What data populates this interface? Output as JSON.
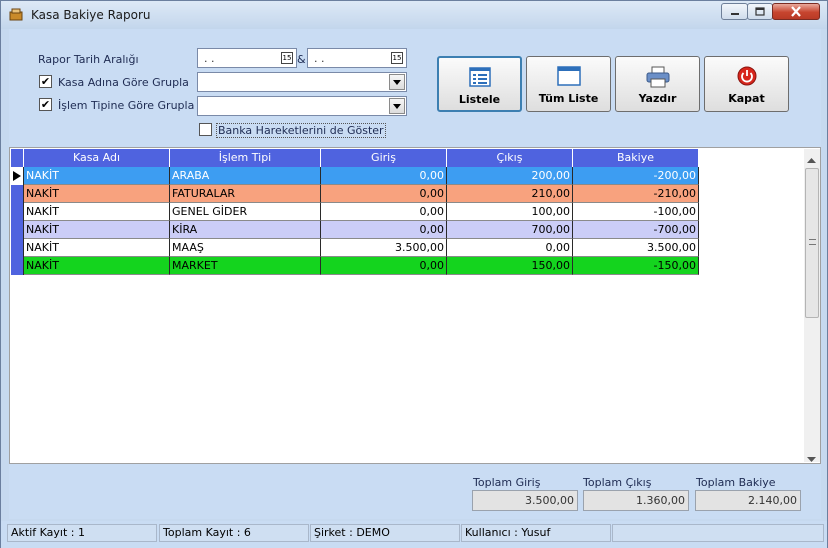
{
  "window": {
    "title": "Kasa Bakiye Raporu"
  },
  "filters": {
    "date_range_label": "Rapor Tarih Aralığı",
    "date_start": ". .",
    "date_end": ". .",
    "date_separator": "&",
    "group_by_cash_label": "Kasa Adına Göre Grupla",
    "group_by_cash_checked": true,
    "group_by_type_label": "İşlem Tipine Göre Grupla",
    "group_by_type_checked": true,
    "show_bank_label": "Banka Hareketlerini de Göster",
    "show_bank_checked": false
  },
  "buttons": {
    "list": "Listele",
    "all_list": "Tüm Liste",
    "print": "Yazdır",
    "close": "Kapat"
  },
  "grid": {
    "columns": [
      "Kasa Adı",
      "İşlem Tipi",
      "Giriş",
      "Çıkış",
      "Bakiye"
    ],
    "rows": [
      {
        "kasa": "NAKİT",
        "tip": "ARABA",
        "giris": "0,00",
        "cikis": "200,00",
        "bakiye": "-200,00",
        "color": "#3d9df2",
        "text_color": "#ffffff",
        "current": true
      },
      {
        "kasa": "NAKİT",
        "tip": "FATURALAR",
        "giris": "0,00",
        "cikis": "210,00",
        "bakiye": "-210,00",
        "color": "#f8a27e",
        "text_color": "#000000",
        "current": false
      },
      {
        "kasa": "NAKİT",
        "tip": "GENEL GİDER",
        "giris": "0,00",
        "cikis": "100,00",
        "bakiye": "-100,00",
        "color": "#ffffff",
        "text_color": "#000000",
        "current": false
      },
      {
        "kasa": "NAKİT",
        "tip": "KİRA",
        "giris": "0,00",
        "cikis": "700,00",
        "bakiye": "-700,00",
        "color": "#cbcdf7",
        "text_color": "#000000",
        "current": false
      },
      {
        "kasa": "NAKİT",
        "tip": "MAAŞ",
        "giris": "3.500,00",
        "cikis": "0,00",
        "bakiye": "3.500,00",
        "color": "#ffffff",
        "text_color": "#000000",
        "current": false
      },
      {
        "kasa": "NAKİT",
        "tip": "MARKET",
        "giris": "0,00",
        "cikis": "150,00",
        "bakiye": "-150,00",
        "color": "#14d41e",
        "text_color": "#000000",
        "current": false
      }
    ]
  },
  "totals": {
    "giris_label": "Toplam Giriş",
    "giris": "3.500,00",
    "cikis_label": "Toplam Çıkış",
    "cikis": "1.360,00",
    "bakiye_label": "Toplam Bakiye",
    "bakiye": "2.140,00"
  },
  "status": {
    "active": "Aktif Kayıt : 1",
    "total": "Toplam Kayıt : 6",
    "company": "Şirket : DEMO",
    "user": "Kullanıcı : Yusuf"
  },
  "icons": {
    "app": "drawer-icon",
    "list": "list-icon",
    "all_list": "window-icon",
    "print": "printer-icon",
    "close": "power-icon"
  }
}
